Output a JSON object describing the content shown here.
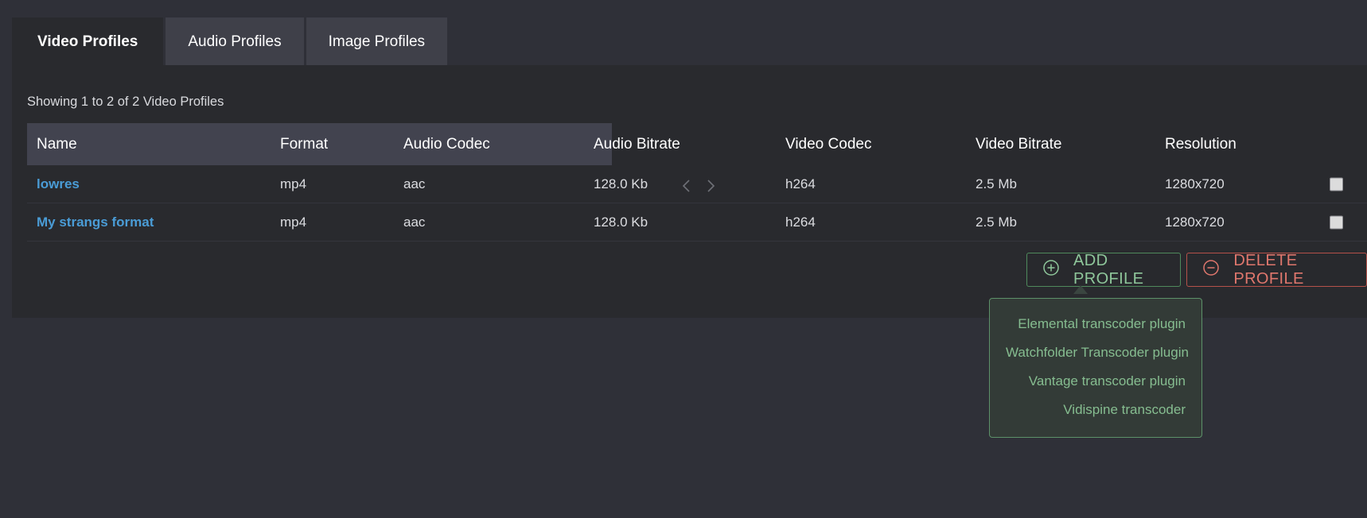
{
  "tabs": [
    {
      "label": "Video Profiles",
      "active": true
    },
    {
      "label": "Audio Profiles",
      "active": false
    },
    {
      "label": "Image Profiles",
      "active": false
    }
  ],
  "showing_text": "Showing 1 to 2 of 2 Video Profiles",
  "table": {
    "columns": [
      "Name",
      "Format",
      "Audio Codec",
      "Audio Bitrate",
      "Video Codec",
      "Video Bitrate",
      "Resolution"
    ],
    "rows": [
      {
        "name": "lowres",
        "format": "mp4",
        "audio_codec": "aac",
        "audio_bitrate": "128.0 Kb",
        "video_codec": "h264",
        "video_bitrate": "2.5 Mb",
        "resolution": "1280x720",
        "selected": false
      },
      {
        "name": "My strangs format",
        "format": "mp4",
        "audio_codec": "aac",
        "audio_bitrate": "128.0 Kb",
        "video_codec": "h264",
        "video_bitrate": "2.5 Mb",
        "resolution": "1280x720",
        "selected": false
      }
    ]
  },
  "pager": {
    "prev_icon": "chevron-left-icon",
    "next_icon": "chevron-right-icon"
  },
  "buttons": {
    "add_profile": {
      "label": "ADD PROFILE",
      "icon": "plus-circle-icon",
      "color": "#8fc79b"
    },
    "delete_profile": {
      "label": "DELETE PROFILE",
      "icon": "minus-circle-icon",
      "color": "#e0776d"
    }
  },
  "dropdown": {
    "open": true,
    "items": [
      "Elemental transcoder plugin",
      "Watchfolder Transcoder plugin",
      "Vantage transcoder plugin",
      "Vidispine transcoder"
    ]
  },
  "colors": {
    "page_background": "#2f3038",
    "panel_background": "#292a2e",
    "tab_inactive": "#3f4049",
    "table_header": "#42434f",
    "link": "#4a9cd6",
    "accent_green": "#5d9169",
    "accent_red": "#b5514a"
  }
}
